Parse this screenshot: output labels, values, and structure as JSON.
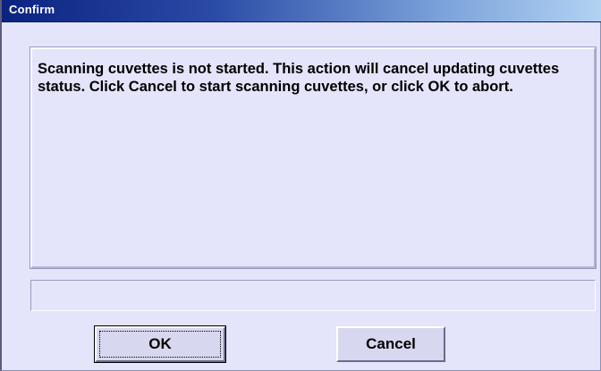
{
  "window": {
    "title": "Confirm"
  },
  "message": {
    "text": "Scanning cuvettes is not started. This action will cancel updating cuvettes status. Click Cancel to start scanning cuvettes, or click OK to abort."
  },
  "status_bar": {
    "text": ""
  },
  "buttons": {
    "ok_label": "OK",
    "cancel_label": "Cancel"
  },
  "colors": {
    "dialog_background": "#e4e4fb",
    "titlebar_start": "#0b2380",
    "titlebar_end": "#b2d2f2",
    "title_text": "#ffffff"
  }
}
